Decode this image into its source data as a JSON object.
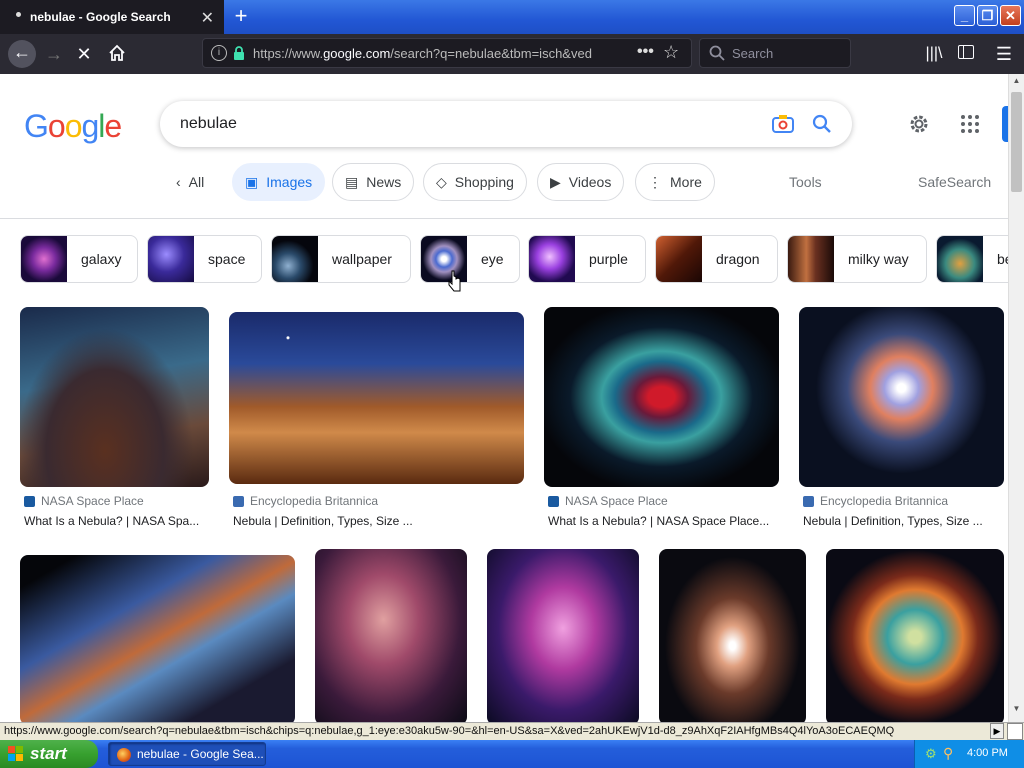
{
  "browser": {
    "tab_title": "nebulae - Google Search",
    "url_prefix": "https://www.",
    "url_domain": "google.com",
    "url_rest": "/search?q=nebulae&tbm=isch&ved",
    "search_placeholder": "Search"
  },
  "google": {
    "logo": "Google",
    "query": "nebulae",
    "tabs": [
      "All",
      "Images",
      "News",
      "Shopping",
      "Videos",
      "More"
    ],
    "tools": "Tools",
    "safesearch": "SafeSearch",
    "related": [
      "galaxy",
      "space",
      "wallpaper",
      "eye",
      "purple",
      "dragon",
      "milky way",
      "be"
    ],
    "results": [
      {
        "source": "NASA Space Place",
        "title": "What Is a Nebula? | NASA Spa..."
      },
      {
        "source": "Encyclopedia Britannica",
        "title": "Nebula | Definition, Types, Size ..."
      },
      {
        "source": "NASA Space Place",
        "title": "What Is a Nebula? | NASA Space Place..."
      },
      {
        "source": "Encyclopedia Britannica",
        "title": "Nebula | Definition, Types, Size ..."
      }
    ]
  },
  "status_url": "https://www.google.com/search?q=nebulae&tbm=isch&chips=q:nebulae,g_1:eye:e30aku5w-90=&hl=en-US&sa=X&ved=2ahUKEwjV1d-d8_z9AhXqF2IAHfgMBs4Q4lYoA3oECAEQMQ",
  "taskbar": {
    "start": "start",
    "item": "nebulae - Google Sea...",
    "clock": "4:00 PM"
  }
}
